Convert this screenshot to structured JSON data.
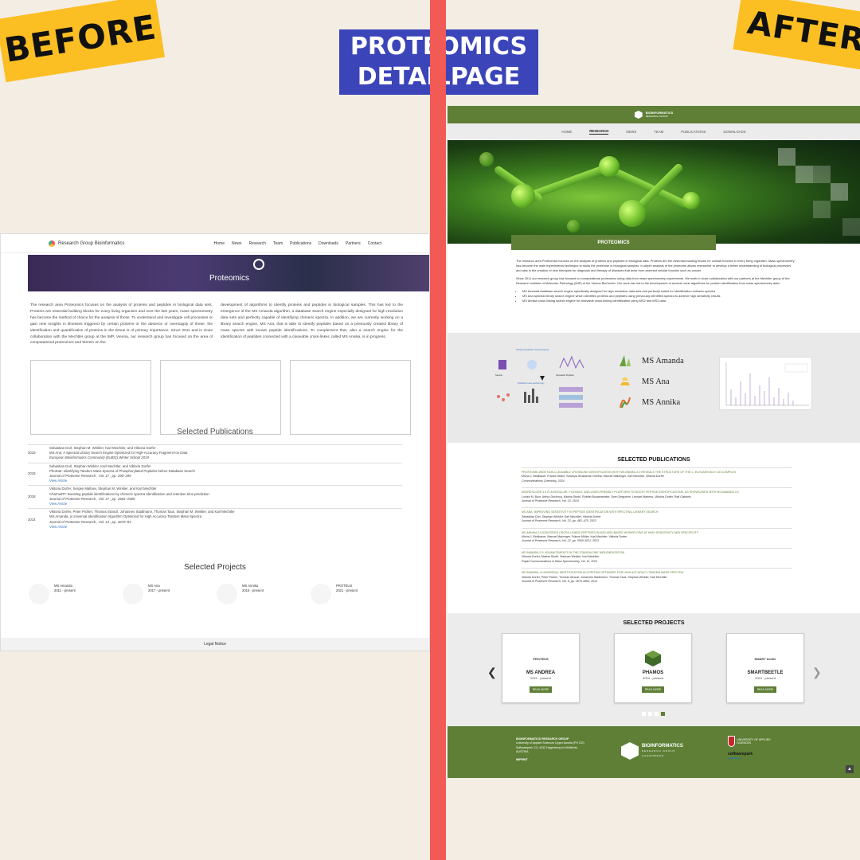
{
  "labels": {
    "before": "BEFORE",
    "after": "AFTER",
    "title_line1": "PROTEOMICS",
    "title_line2": "DETAILPAGE"
  },
  "colors": {
    "accent_green": "#5e7f35",
    "divider": "#f25a56",
    "title_bg": "#3b44b8",
    "tag_bg": "#fbbf24"
  },
  "before": {
    "brand": "Research Group Bioinformatics",
    "nav": [
      "Home",
      "News",
      "Research",
      "Team",
      "Publications",
      "Downloads",
      "Partners",
      "Contact"
    ],
    "hero_title": "Proteomics",
    "col1": "The research area Proteomics focuses on the analysis of proteins and peptides in biological data sets. Proteins are essential building blocks for every living organism and over the last years, mass spectrometry has become the method of choice for the analysis of those. To understand and investigate cell processes or gain new insights in illnesses triggered by certain proteins or the absence or oversupply of these, the identification and quantification of proteins in the tissue is of primary importance. Since 2011 and in close collaboration with the Mechtler group at the IMP, Vienna, our research group has focused on the area of computational proteomics and therein on the",
    "col2": "development of algorithms to identify proteins and peptides in biological samples. This has led to the emergence of the MS Amanda algorithm, a database search engine especially designed for high resolution data sets and perfectly capable of identifying chimeric spectra. In addition, we are currently working on a library search engine, MS Ana, that is able to identify peptides based on a previously created library of mass spectra with known peptide identifications. To complement that, also a search engine for the identification of peptides connected with a cleavable cross-linker, called MS Annika, is in progress.",
    "pubs_title": "Selected Publications",
    "pubs": [
      {
        "year": "2019",
        "authors": "Sebastian Dorl, Stephan M. Winkler, Karl Mechtler, and Viktoria Dorfer",
        "title": "MS Ana: A Spectral Library Search Engine Optimized for High-Accuracy Fragment Ion Data",
        "journal": "European Bioinformatics Community (EuBIC) Winter School 2019",
        "link": ""
      },
      {
        "year": "2018",
        "authors": "Sebastian Dorl, Stephan Winkler, Karl Mechtler, and Viktoria Dorfer",
        "title": "PhoStar: Identifying Tandem Mass Spectra of Phosphorylated Peptides before Database Search",
        "journal": "Journal of Proteome Research , Vol. 17 , pp. 290–295",
        "link": "View Article"
      },
      {
        "year": "2018",
        "authors": "Viktoria Dorfer, Sergey Maltsev, Stephan M. Winkler, and Karl Mechtler",
        "title": "CharmeRT: Boosting peptide identifications by chimeric spectra identification and retention time prediction",
        "journal": "Journal of Proteome Research , Vol. 17 , pp. 2581–2589",
        "link": "View Article"
      },
      {
        "year": "2014",
        "authors": "Viktoria Dorfer, Peter Pichler, Thomas Stranzl, Johannes Stadlmann, Thomas Taus, Stephan M. Winkler, and Karl Mechtler",
        "title": "MS Amanda, a Universal Identification Algorithm Optimized for High Accuracy Tandem Mass Spectra",
        "journal": "Journal of Proteome Research , Vol. 13 , pp. 3679–84",
        "link": "View Article"
      }
    ],
    "projects_title": "Selected Projects",
    "projects": [
      {
        "name": "MS Amanda",
        "date": "2011 - present"
      },
      {
        "name": "MS Ana",
        "date": "2017 - present"
      },
      {
        "name": "MS Annika",
        "date": "2016 - present"
      },
      {
        "name": "PROTEUS",
        "date": "2021 - present"
      }
    ],
    "footer": "Legal Notice"
  },
  "after": {
    "top_logo": "BIOINFORMATICS",
    "top_logo_sub": "RESEARCH GROUP",
    "nav": [
      "HOME",
      "RESEARCH",
      "NEWS",
      "TEAM",
      "PUBLICATIONS",
      "DOWNLOADS"
    ],
    "nav_active": "RESEARCH",
    "hero_bar": "PROTEOMICS",
    "intro_p1": "The research area Proteomics focuses on the analysis of proteins and peptides in biological data. Proteins are the essential building blocks for cellular function in every living organism. Mass spectrometry has become the main experimental technique to study the proteome in biological samples. In-depth analysis of the proteome allows researcher to develop a better understanding of biological processes and aids in the creation of new therapies for diagnosis and therapy of diseases that arise from aberrant cellular function such as cancer.",
    "intro_p2": "Since 2011 our research group has focused on computational proteomics using data from mass spectrometry experiments. We work in close collaboration with our partners at the Mechtler group of the Research Institute of Molecular Pathology (IMP) at the Vienna BioCenter. Our work has led to the development of several novel algorithms for protein identification from mass spectrometry data:",
    "bullets": [
      "MS Amanda database search engine specifically designed for high resolution data sets and perfectly suited for identification chimeric spectra",
      "MS Ana spectral library search engine which identifies proteins and peptides using previously identified spectra to achieve high sensitivity results",
      "MS Annika cross linking search engine for cleavable cross-linking identification using MS2 and MS3 data"
    ],
    "diagram": {
      "top": "Sample preparation and processing",
      "mid": "Sample",
      "right": "Separated Peptides",
      "bottom": "Predicted mass spectrometry"
    },
    "ms_names": [
      "MS Amanda",
      "MS Ana",
      "MS Annika"
    ],
    "pubs_title": "SELECTED PUBLICATIONS",
    "pubs": [
      {
        "title": "PROTEOME-WIDE NON-CLEAVABLE CROSSLINK IDENTIFICATION WITH MS ANNIKA 3.0 REVEALS THE STRUCTURE OF THE C. ELEGANS BOX C/D COMPLEX",
        "authors": "Micha J. Birklbauer, Fränze Müller, Sowmya Sivakumar Geetha, Manuel Matzinger, Karl Mechtler, Viktoria Dorfer",
        "journal": "Communications Chemistry, 2024"
      },
      {
        "title": "MS2RESCORE 3.0 IS A MODULAR, FLEXIBLE, AND USER-FRIENDLY PLATFORM TO BOOST PEPTIDE IDENTIFICATIONS, AS SHOWCASED WITH MS AMANDA 3.0",
        "authors": "Louise M. Buur, Arthur Declercq, Marina Strobl, Robbin Bouwmeester, Sven Degroeve, Lennart Martens, Viktoria Dorfer, Ralf Gabriels",
        "journal": "Journal of Proteome Research, Vol. 23, 2024"
      },
      {
        "title": "MS ANA: IMPROVING SENSITIVITY IN PEPTIDE IDENTIFICATION WITH SPECTRAL LIBRARY SEARCH",
        "authors": "Sebastian Dorl, Stephan Winkler, Karl Mechtler, Viktoria Dorfer",
        "journal": "Journal of Proteome Research, Vol. 22, pp. 462–470, 2023"
      },
      {
        "title": "MS ANNIKA 2.0 IDENTIFIES CROSS-LINKED PEPTIDES IN MS2-MS3-BASED WORKFLOWS AT HIGH SENSITIVITY AND SPECIFICITY",
        "authors": "Micha J. Birklbauer, Manuel Matzinger, Fränze Müller, Karl Mechtler, Viktoria Dorfer",
        "journal": "Journal of Proteome Research, Vol. 22, pp. 3009-3021, 2023"
      },
      {
        "title": "MS AMANDA 2.0: ADVANCEMENTS IN THE STANDALONE IMPLEMENTATION",
        "authors": "Viktoria Dorfer, Marina Strobl, Stephan Winkler, Karl Mechtler",
        "journal": "Rapid Communications in Mass Spectrometry, Vol. 11, 2021"
      },
      {
        "title": "MS AMANDA, A UNIVERSAL IDENTIFICATION ALGORITHM OPTIMIZED FOR HIGH ACCURACY TANDEM MASS SPECTRA",
        "authors": "Viktoria Dorfer, Peter Pichler, Thomas Stranzl, Johannes Stadlmann, Thomas Taus, Stephan Winkler, Karl Mechtler",
        "journal": "Journal of Proteome Research, Vol. 8, pp. 3679-3684, 2014"
      }
    ],
    "projects_title": "SELECTED PROJECTS",
    "projects": [
      {
        "logo": "PROTEUS",
        "name": "MS ANDREA",
        "date": "2021 - present",
        "btn": "READ MORE"
      },
      {
        "logo": "",
        "name": "PHAMOS",
        "date": "2024 - present",
        "btn": "READ MORE"
      },
      {
        "logo": "SMART beetle",
        "name": "SMARTBEETLE",
        "date": "2024 - present",
        "btn": "READ MORE"
      }
    ],
    "footer": {
      "org": "BIOINFORMATICS RESEARCH GROUP",
      "line1": "University of Applied Sciences Upper Austria (FH OÖ)",
      "line2": "Softwarepark 13 | 4232 Hagenberg im Mühlkreis",
      "line3": "AUSTRIA",
      "imprint": "IMPRINT",
      "logo": "BIOINFORMATICS",
      "logo_sub1": "RESEARCH GROUP",
      "logo_sub2": "HAGENBERG",
      "uni": "UNIVERSITY OF APPLIED SCIENCES",
      "swp": "softwarepark",
      "swp_sub": "Hagenberg"
    }
  }
}
